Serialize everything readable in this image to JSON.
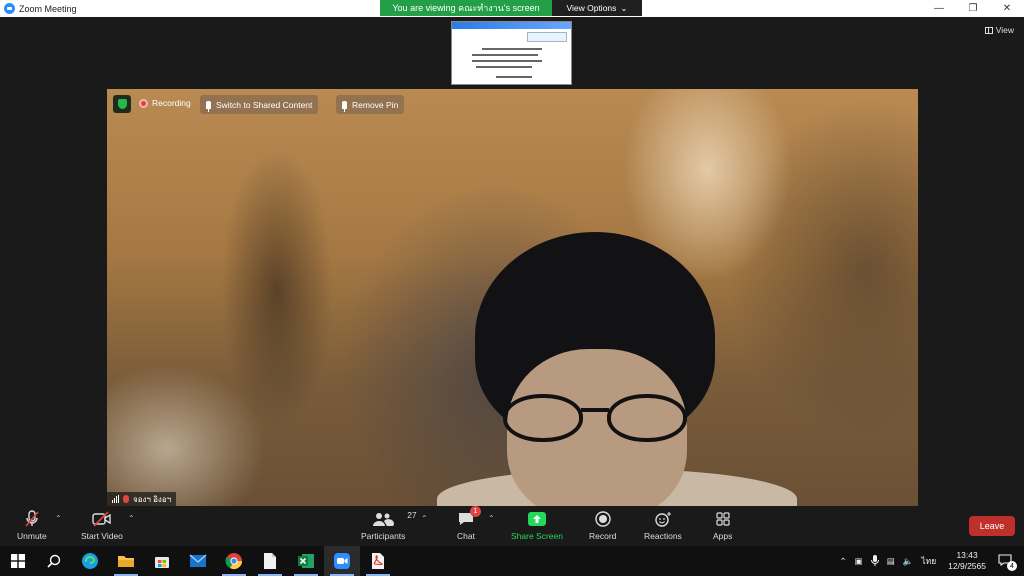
{
  "window": {
    "title": "Zoom Meeting"
  },
  "banner": {
    "viewing_text": "You are viewing คณะทำงาน's screen",
    "view_options_label": "View Options"
  },
  "view_button": {
    "label": "View"
  },
  "video_overlay": {
    "recording_label": "Recording",
    "switch_label": "Switch to Shared Content",
    "remove_pin_label": "Remove Pin"
  },
  "participant": {
    "name": "จองฯ อิงอฯ"
  },
  "toolbar": {
    "unmute_label": "Unmute",
    "start_video_label": "Start Video",
    "participants_label": "Participants",
    "participants_count": "27",
    "chat_label": "Chat",
    "chat_badge": "1",
    "share_label": "Share Screen",
    "record_label": "Record",
    "reactions_label": "Reactions",
    "apps_label": "Apps",
    "leave_label": "Leave",
    "share_color": "#23d959"
  },
  "taskbar": {
    "language": "ไทย",
    "time": "13:43",
    "date": "12/9/2565",
    "notification_count": "4",
    "icons": [
      "windows-start-icon",
      "search-icon",
      "edge-icon",
      "file-explorer-icon",
      "store-icon",
      "mail-icon",
      "chrome-icon",
      "notepad-icon",
      "excel-icon",
      "zoom-icon",
      "pdf-icon"
    ]
  }
}
